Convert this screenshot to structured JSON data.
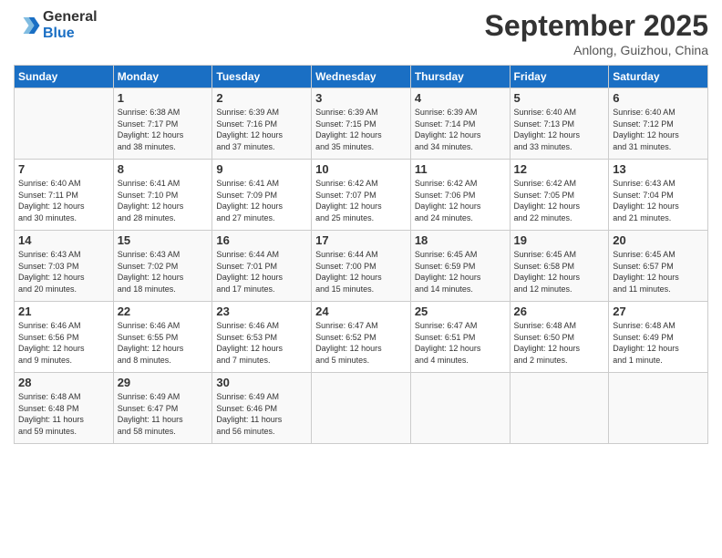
{
  "header": {
    "logo_line1": "General",
    "logo_line2": "Blue",
    "month_title": "September 2025",
    "location": "Anlong, Guizhou, China"
  },
  "days_of_week": [
    "Sunday",
    "Monday",
    "Tuesday",
    "Wednesday",
    "Thursday",
    "Friday",
    "Saturday"
  ],
  "weeks": [
    [
      {
        "num": "",
        "info": ""
      },
      {
        "num": "1",
        "info": "Sunrise: 6:38 AM\nSunset: 7:17 PM\nDaylight: 12 hours\nand 38 minutes."
      },
      {
        "num": "2",
        "info": "Sunrise: 6:39 AM\nSunset: 7:16 PM\nDaylight: 12 hours\nand 37 minutes."
      },
      {
        "num": "3",
        "info": "Sunrise: 6:39 AM\nSunset: 7:15 PM\nDaylight: 12 hours\nand 35 minutes."
      },
      {
        "num": "4",
        "info": "Sunrise: 6:39 AM\nSunset: 7:14 PM\nDaylight: 12 hours\nand 34 minutes."
      },
      {
        "num": "5",
        "info": "Sunrise: 6:40 AM\nSunset: 7:13 PM\nDaylight: 12 hours\nand 33 minutes."
      },
      {
        "num": "6",
        "info": "Sunrise: 6:40 AM\nSunset: 7:12 PM\nDaylight: 12 hours\nand 31 minutes."
      }
    ],
    [
      {
        "num": "7",
        "info": "Sunrise: 6:40 AM\nSunset: 7:11 PM\nDaylight: 12 hours\nand 30 minutes."
      },
      {
        "num": "8",
        "info": "Sunrise: 6:41 AM\nSunset: 7:10 PM\nDaylight: 12 hours\nand 28 minutes."
      },
      {
        "num": "9",
        "info": "Sunrise: 6:41 AM\nSunset: 7:09 PM\nDaylight: 12 hours\nand 27 minutes."
      },
      {
        "num": "10",
        "info": "Sunrise: 6:42 AM\nSunset: 7:07 PM\nDaylight: 12 hours\nand 25 minutes."
      },
      {
        "num": "11",
        "info": "Sunrise: 6:42 AM\nSunset: 7:06 PM\nDaylight: 12 hours\nand 24 minutes."
      },
      {
        "num": "12",
        "info": "Sunrise: 6:42 AM\nSunset: 7:05 PM\nDaylight: 12 hours\nand 22 minutes."
      },
      {
        "num": "13",
        "info": "Sunrise: 6:43 AM\nSunset: 7:04 PM\nDaylight: 12 hours\nand 21 minutes."
      }
    ],
    [
      {
        "num": "14",
        "info": "Sunrise: 6:43 AM\nSunset: 7:03 PM\nDaylight: 12 hours\nand 20 minutes."
      },
      {
        "num": "15",
        "info": "Sunrise: 6:43 AM\nSunset: 7:02 PM\nDaylight: 12 hours\nand 18 minutes."
      },
      {
        "num": "16",
        "info": "Sunrise: 6:44 AM\nSunset: 7:01 PM\nDaylight: 12 hours\nand 17 minutes."
      },
      {
        "num": "17",
        "info": "Sunrise: 6:44 AM\nSunset: 7:00 PM\nDaylight: 12 hours\nand 15 minutes."
      },
      {
        "num": "18",
        "info": "Sunrise: 6:45 AM\nSunset: 6:59 PM\nDaylight: 12 hours\nand 14 minutes."
      },
      {
        "num": "19",
        "info": "Sunrise: 6:45 AM\nSunset: 6:58 PM\nDaylight: 12 hours\nand 12 minutes."
      },
      {
        "num": "20",
        "info": "Sunrise: 6:45 AM\nSunset: 6:57 PM\nDaylight: 12 hours\nand 11 minutes."
      }
    ],
    [
      {
        "num": "21",
        "info": "Sunrise: 6:46 AM\nSunset: 6:56 PM\nDaylight: 12 hours\nand 9 minutes."
      },
      {
        "num": "22",
        "info": "Sunrise: 6:46 AM\nSunset: 6:55 PM\nDaylight: 12 hours\nand 8 minutes."
      },
      {
        "num": "23",
        "info": "Sunrise: 6:46 AM\nSunset: 6:53 PM\nDaylight: 12 hours\nand 7 minutes."
      },
      {
        "num": "24",
        "info": "Sunrise: 6:47 AM\nSunset: 6:52 PM\nDaylight: 12 hours\nand 5 minutes."
      },
      {
        "num": "25",
        "info": "Sunrise: 6:47 AM\nSunset: 6:51 PM\nDaylight: 12 hours\nand 4 minutes."
      },
      {
        "num": "26",
        "info": "Sunrise: 6:48 AM\nSunset: 6:50 PM\nDaylight: 12 hours\nand 2 minutes."
      },
      {
        "num": "27",
        "info": "Sunrise: 6:48 AM\nSunset: 6:49 PM\nDaylight: 12 hours\nand 1 minute."
      }
    ],
    [
      {
        "num": "28",
        "info": "Sunrise: 6:48 AM\nSunset: 6:48 PM\nDaylight: 11 hours\nand 59 minutes."
      },
      {
        "num": "29",
        "info": "Sunrise: 6:49 AM\nSunset: 6:47 PM\nDaylight: 11 hours\nand 58 minutes."
      },
      {
        "num": "30",
        "info": "Sunrise: 6:49 AM\nSunset: 6:46 PM\nDaylight: 11 hours\nand 56 minutes."
      },
      {
        "num": "",
        "info": ""
      },
      {
        "num": "",
        "info": ""
      },
      {
        "num": "",
        "info": ""
      },
      {
        "num": "",
        "info": ""
      }
    ]
  ]
}
